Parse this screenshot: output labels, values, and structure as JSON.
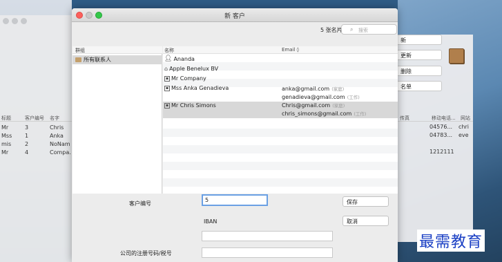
{
  "dialog": {
    "title": "新 客户",
    "card_count": "5 张名片",
    "search": {
      "icon": "search-icon",
      "placeholder": "搜索"
    },
    "groups": {
      "header": "群组",
      "items": [
        {
          "label": "所有联系人",
          "icon": "folder-icon",
          "selected": true
        }
      ]
    },
    "contacts": {
      "columns": {
        "name": "名称",
        "email": "Email ◊"
      },
      "rows": [
        {
          "name": "Ananda",
          "icon": "person-icon",
          "emails": []
        },
        {
          "name": "Apple Benelux BV",
          "icon": "building-icon",
          "emails": []
        },
        {
          "name": "Mr Company",
          "icon": "card-icon",
          "emails": []
        },
        {
          "name": "Mss Anka Genadieva",
          "icon": "card-icon",
          "emails": [
            {
              "address": "anka@gmail.com",
              "tag": "(家庭)"
            },
            {
              "address": "genadieva@gmail.com",
              "tag": "(工作)"
            }
          ]
        },
        {
          "name": "Mr Chris Simons",
          "icon": "card-icon",
          "selected": true,
          "emails": [
            {
              "address": "Chris@gmail.com",
              "tag": "(家庭)"
            },
            {
              "address": "chris_simons@gmail.com",
              "tag": "(工作)"
            }
          ]
        }
      ]
    },
    "form": {
      "customer_number_label": "客户编号",
      "customer_number_value": "5",
      "iban_label": "IBAN",
      "iban_value": "",
      "company_reg_label": "公司的注册号码/税号",
      "company_reg_value": "",
      "save_label": "保存",
      "cancel_label": "取消"
    }
  },
  "background": {
    "buttons": [
      "新",
      "更新",
      "删除",
      "名单"
    ],
    "left_table": {
      "headers": [
        "标题",
        "客户编号",
        "名字"
      ],
      "rows": [
        [
          "Mr",
          "3",
          "Chris"
        ],
        [
          "Mss",
          "1",
          "Anka"
        ],
        [
          "mis",
          "2",
          "NoNam"
        ],
        [
          "Mr",
          "4",
          "Compa."
        ]
      ]
    },
    "right_table": {
      "headers": [
        "传真",
        "移动电话...",
        "网站"
      ],
      "rows": [
        [
          "",
          "04576...",
          "chri"
        ],
        [
          "",
          "04783...",
          "eve"
        ],
        [
          "",
          "",
          ""
        ],
        [
          "",
          "1212111",
          ""
        ]
      ]
    }
  },
  "watermark": "最需教育"
}
